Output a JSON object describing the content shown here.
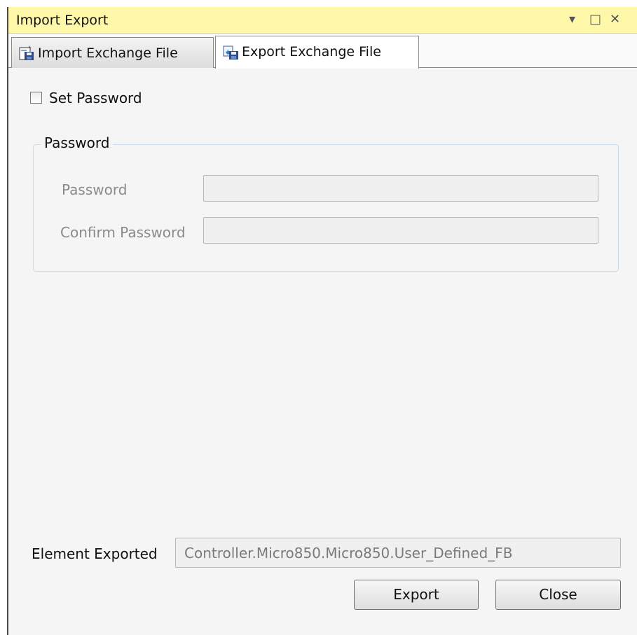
{
  "window": {
    "title": "Import Export",
    "controls": {
      "dropdown": "▾",
      "maximize": "□",
      "close": "✕"
    }
  },
  "tabs": [
    {
      "label": "Import Exchange File",
      "icon": "import-file-icon",
      "active": false
    },
    {
      "label": "Export Exchange File",
      "icon": "export-file-icon",
      "active": true
    }
  ],
  "set_password": {
    "label": "Set Password",
    "checked": false
  },
  "password_group": {
    "legend": "Password",
    "password_label": "Password",
    "password_value": "",
    "confirm_label": "Confirm Password",
    "confirm_value": ""
  },
  "element_exported": {
    "label": "Element Exported",
    "value": "Controller.Micro850.Micro850.User_Defined_FB"
  },
  "buttons": {
    "export": "Export",
    "close": "Close"
  },
  "colors": {
    "titlebar": "#fff8a8",
    "window_bg": "#f5f5f5",
    "disabled_text": "#8a8a8a"
  }
}
